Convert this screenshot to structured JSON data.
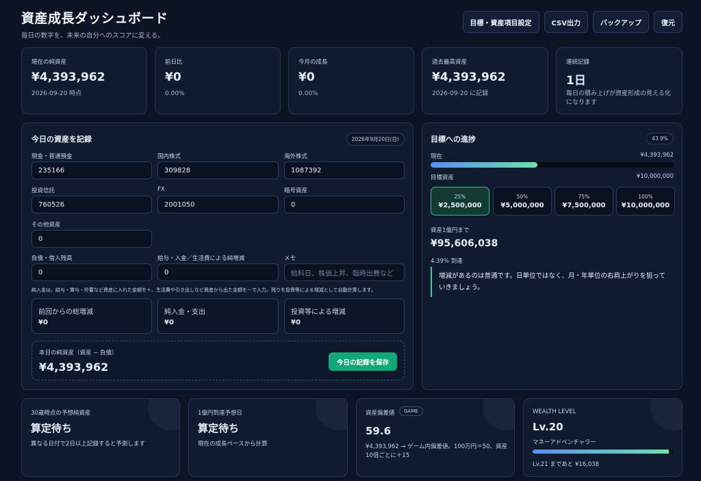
{
  "header": {
    "title": "資産成長ダッシュボード",
    "subtitle": "毎日の数字を、未来の自分へのスコアに変える。"
  },
  "actions": [
    "目標・資産項目設定",
    "CSV出力",
    "バックアップ",
    "復元"
  ],
  "stats": [
    {
      "label": "現在の純資産",
      "value": "¥4,393,962",
      "sub": "2026-09-20 時点"
    },
    {
      "label": "前日比",
      "value": "¥0",
      "sub": "0.00%"
    },
    {
      "label": "今月の成長",
      "value": "¥0",
      "sub": "0.00%"
    },
    {
      "label": "過去最高資産",
      "value": "¥4,393,962",
      "sub": "2026-09-20 に記録"
    },
    {
      "label": "連続記録",
      "value": "1日",
      "sub": "毎日の積み上げが資産形成の見える化になります"
    }
  ],
  "record": {
    "title": "今日の資産を記録",
    "date": "2026年9月20日(日)",
    "fields": [
      {
        "label": "現金・普通預金",
        "value": "235166"
      },
      {
        "label": "国内株式",
        "value": "309828"
      },
      {
        "label": "海外株式",
        "value": "1087392"
      },
      {
        "label": "投資信託",
        "value": "760526"
      },
      {
        "label": "FX",
        "value": "2001050"
      },
      {
        "label": "暗号資産",
        "value": "0"
      },
      {
        "label": "その他資産",
        "value": "0"
      },
      {
        "label": "負債・借入残高",
        "value": "0"
      },
      {
        "label": "給与・入金／生活費による純増減",
        "value": "0"
      },
      {
        "label": "メモ",
        "value": "",
        "placeholder": "給料日、株価上昇、臨時出費など"
      }
    ],
    "note": "純入金は、給与・賞与・貯蓄など資産に入れた金額を＋、生活費や引き出しなど資産から出た金額を－で入力。残りを投資等による増減として自動計算します。",
    "summary": [
      {
        "label": "前回からの総増減",
        "value": "¥0"
      },
      {
        "label": "純入金・支出",
        "value": "¥0"
      },
      {
        "label": "投資等による増減",
        "value": "¥0"
      }
    ],
    "net_label": "本日の純資産（資産 − 負債）",
    "net_value": "¥4,393,962",
    "save_label": "今日の記録を保存"
  },
  "goal": {
    "title": "目標への進捗",
    "percent_badge": "43.9%",
    "progress": 0.439,
    "current_label": "現在",
    "current_value": "¥4,393,962",
    "target_label": "目標資産",
    "target_value": "¥10,000,000",
    "milestones": [
      {
        "pct": "25%",
        "amount": "¥2,500,000",
        "active": true
      },
      {
        "pct": "50%",
        "amount": "¥5,000,000",
        "active": false
      },
      {
        "pct": "75%",
        "amount": "¥7,500,000",
        "active": false
      },
      {
        "pct": "100%",
        "amount": "¥10,000,000",
        "active": false
      }
    ],
    "oku_label": "資産1億円まで",
    "oku_value": "¥95,606,038",
    "oku_sub": "4.39% 到達",
    "quote": "増減があるのは普通です。日単位ではなく、月・年単位の右肩上がりを狙っていきましょう。"
  },
  "bottom": [
    {
      "label": "30歳時点の予想純資産",
      "value": "算定待ち",
      "sub": "異なる日付で2日以上記録すると予測します"
    },
    {
      "label": "1億円到達予想日",
      "value": "算定待ち",
      "sub": "現在の成長ペースから計算"
    },
    {
      "label": "資産偏差値",
      "badge": "GAME",
      "value": "59.6",
      "sub": "¥4,393,962 → ゲーム内偏差値。100万円＝50、資産10倍ごとに＋15"
    },
    {
      "label": "WEALTH LEVEL",
      "value": "Lv.20",
      "title": "マネーアドベンチャラー",
      "progress": 0.97,
      "sub": "Lv.21 まであと ¥16,038"
    }
  ]
}
